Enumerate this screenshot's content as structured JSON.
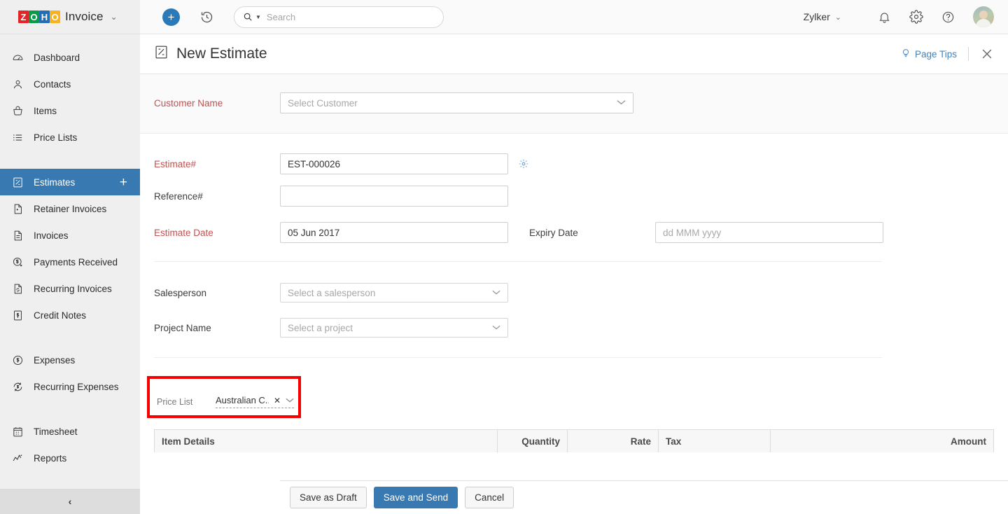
{
  "brand": {
    "logo_tiles": [
      "Z",
      "O",
      "H",
      "O"
    ],
    "product": "Invoice",
    "caret": "⌄"
  },
  "sidebar": {
    "items": [
      {
        "label": "Dashboard",
        "icon": "gauge-icon",
        "active": false
      },
      {
        "label": "Contacts",
        "icon": "person-icon",
        "active": false
      },
      {
        "label": "Items",
        "icon": "basket-icon",
        "active": false
      },
      {
        "label": "Price Lists",
        "icon": "list-icon",
        "active": false
      },
      {
        "label": "Estimates",
        "icon": "estimate-icon",
        "active": true,
        "plus": "+"
      },
      {
        "label": "Retainer Invoices",
        "icon": "doc-dot-icon",
        "active": false
      },
      {
        "label": "Invoices",
        "icon": "doc-lines-icon",
        "active": false
      },
      {
        "label": "Payments Received",
        "icon": "dollar-circle-down-icon",
        "active": false
      },
      {
        "label": "Recurring Invoices",
        "icon": "doc-refresh-icon",
        "active": false
      },
      {
        "label": "Credit Notes",
        "icon": "doc-dollar-icon",
        "active": false
      },
      {
        "label": "Expenses",
        "icon": "dollar-circle-icon",
        "active": false
      },
      {
        "label": "Recurring Expenses",
        "icon": "dollar-refresh-icon",
        "active": false
      },
      {
        "label": "Timesheet",
        "icon": "calendar-icon",
        "active": false
      },
      {
        "label": "Reports",
        "icon": "chart-line-icon",
        "active": false
      }
    ],
    "collapse_chevron": "‹"
  },
  "topbar": {
    "add_label": "+",
    "history_icon": "clock-rewind-icon",
    "search": {
      "placeholder": "Search",
      "value": ""
    },
    "org_name": "Zylker",
    "org_caret": "⌄",
    "notifications_icon": "bell-icon",
    "settings_icon": "gear-icon",
    "help_icon": "question-circle-icon",
    "avatar_icon": "user-avatar"
  },
  "page": {
    "title": "New Estimate",
    "title_icon": "estimate-icon",
    "page_tips": "Page Tips",
    "page_tips_icon": "bulb-icon",
    "close_icon": "close-icon"
  },
  "form": {
    "customer_name": {
      "label": "Customer Name",
      "required": true,
      "placeholder": "Select Customer",
      "value": ""
    },
    "estimate_number": {
      "label": "Estimate#",
      "required": true,
      "value": "EST-000026",
      "settings_icon": "gear-icon"
    },
    "reference_number": {
      "label": "Reference#",
      "required": false,
      "value": "",
      "placeholder": ""
    },
    "estimate_date": {
      "label": "Estimate Date",
      "required": true,
      "value": "05 Jun 2017"
    },
    "expiry_date": {
      "label": "Expiry Date",
      "required": false,
      "value": "",
      "placeholder": "dd MMM yyyy"
    },
    "salesperson": {
      "label": "Salesperson",
      "required": false,
      "placeholder": "Select a salesperson",
      "value": ""
    },
    "project_name": {
      "label": "Project Name",
      "required": false,
      "placeholder": "Select a project",
      "value": ""
    },
    "price_list": {
      "label": "Price List",
      "value": "Australian C...",
      "clear_icon": "✕",
      "chevron": "⌄",
      "highlight_color": "#f50000"
    }
  },
  "items_table": {
    "columns": [
      {
        "key": "item_details",
        "label": "Item Details"
      },
      {
        "key": "quantity",
        "label": "Quantity"
      },
      {
        "key": "rate",
        "label": "Rate"
      },
      {
        "key": "tax",
        "label": "Tax"
      },
      {
        "key": "amount",
        "label": "Amount"
      }
    ],
    "rows": []
  },
  "footer": {
    "save_draft": "Save as Draft",
    "save_send": "Save and Send",
    "cancel": "Cancel"
  },
  "colors": {
    "accent": "#3779b0",
    "required": "#c45050",
    "link": "#3b83c4",
    "highlight": "#f50000",
    "sidebar_bg": "#efefef"
  }
}
